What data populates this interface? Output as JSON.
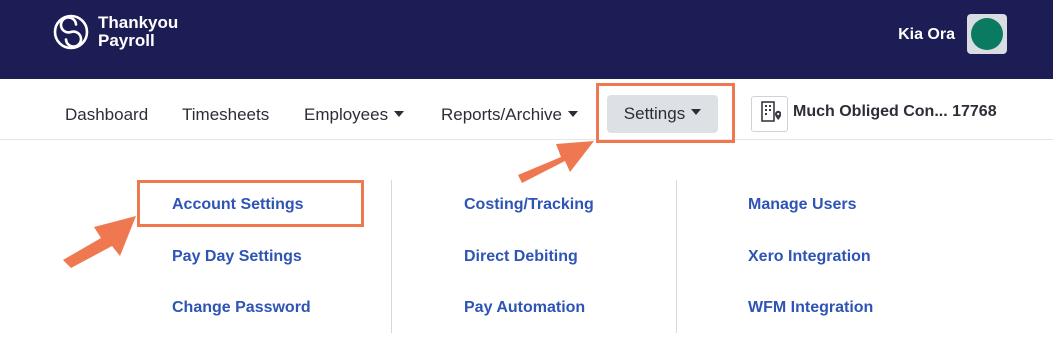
{
  "header": {
    "brand_line1": "Thankyou",
    "brand_line2": "Payroll",
    "greeting": "Kia Ora",
    "logo_icon": "thankyou-payroll-logo-icon",
    "avatar_color": "#0a7a60",
    "background": "#1d1d55"
  },
  "nav": {
    "dashboard": "Dashboard",
    "timesheets": "Timesheets",
    "employees": "Employees",
    "reports": "Reports/Archive",
    "settings": "Settings",
    "company_icon": "building-location-icon",
    "company": "Much Obliged Con... 17768"
  },
  "settings_menu": {
    "col1": [
      "Account Settings",
      "Pay Day Settings",
      "Change Password"
    ],
    "col2": [
      "Costing/Tracking",
      "Direct Debiting",
      "Pay Automation"
    ],
    "col3": [
      "Manage Users",
      "Xero Integration",
      "WFM Integration"
    ],
    "link_color": "#2e54b4"
  },
  "annotations": {
    "color": "#f07850",
    "highlighted": [
      "Settings",
      "Account Settings"
    ]
  }
}
